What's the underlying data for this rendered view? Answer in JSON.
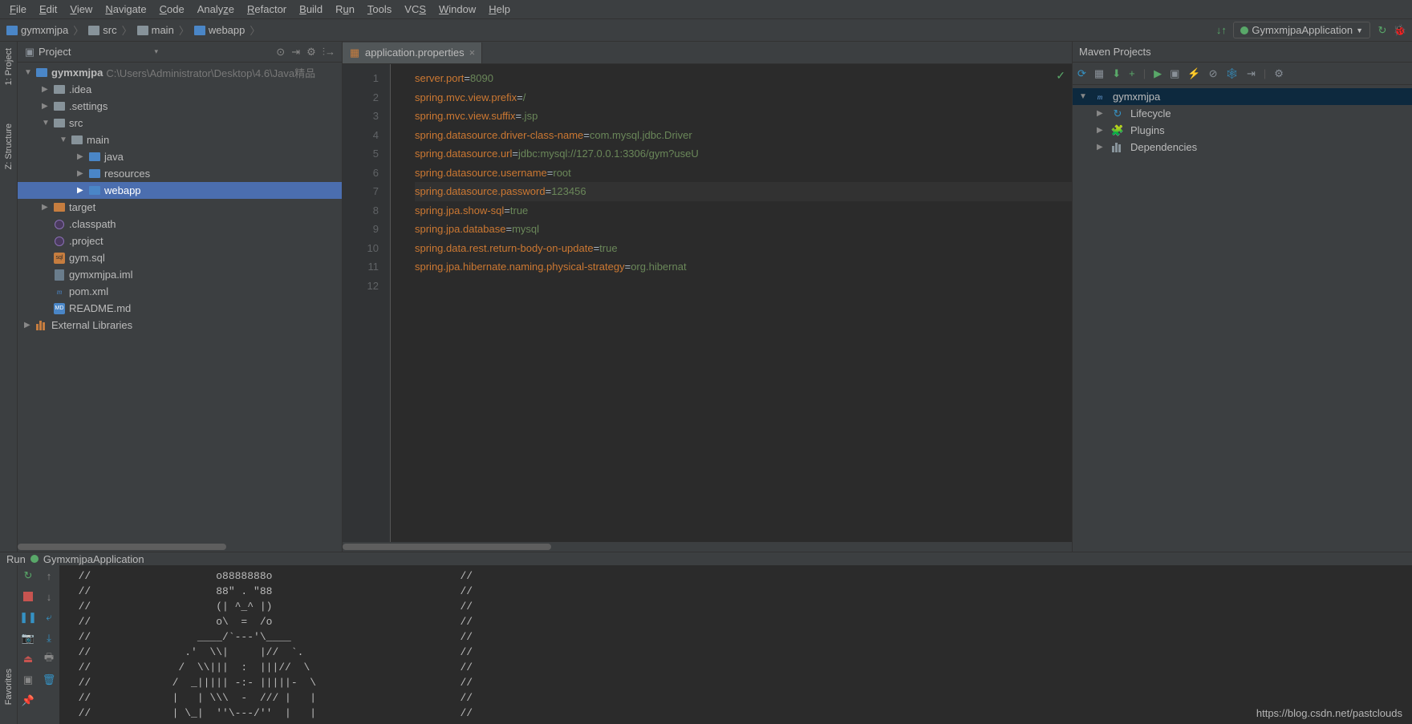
{
  "menu": [
    "File",
    "Edit",
    "View",
    "Navigate",
    "Code",
    "Analyze",
    "Refactor",
    "Build",
    "Run",
    "Tools",
    "VCS",
    "Window",
    "Help"
  ],
  "breadcrumb": [
    "gymxmjpa",
    "src",
    "main",
    "webapp"
  ],
  "run_config": "GymxmjpaApplication",
  "project_panel": {
    "title": "Project",
    "root": {
      "name": "gymxmjpa",
      "path": "C:\\Users\\Administrator\\Desktop\\4.6\\Java精品"
    },
    "items": {
      "idea": ".idea",
      "settings": ".settings",
      "src": "src",
      "main": "main",
      "java": "java",
      "resources": "resources",
      "webapp": "webapp",
      "target": "target",
      "classpath": ".classpath",
      "project": ".project",
      "gymsql": "gym.sql",
      "iml": "gymxmjpa.iml",
      "pom": "pom.xml",
      "readme": "README.md",
      "ext": "External Libraries"
    }
  },
  "editor": {
    "tab": "application.properties",
    "lines": [
      {
        "n": 1,
        "k": "server.port",
        "v": "8090"
      },
      {
        "n": 2,
        "k": "spring.mvc.view.prefix",
        "v": "/"
      },
      {
        "n": 3,
        "k": "spring.mvc.view.suffix",
        "v": ".jsp"
      },
      {
        "n": 4,
        "k": "spring.datasource.driver-class-name",
        "v": "com.mysql.jdbc.Driver"
      },
      {
        "n": 5,
        "k": "spring.datasource.url",
        "v": "jdbc:mysql://127.0.0.1:3306/gym?useU"
      },
      {
        "n": 6,
        "k": "spring.datasource.username",
        "v": "root"
      },
      {
        "n": 7,
        "k": "spring.datasource.password",
        "v": "123456"
      },
      {
        "n": 8,
        "k": "spring.jpa.show-sql",
        "v": "true"
      },
      {
        "n": 9,
        "k": "spring.jpa.database",
        "v": "mysql"
      },
      {
        "n": 10,
        "k": "spring.data.rest.return-body-on-update",
        "v": "true"
      },
      {
        "n": 11,
        "k": "spring.jpa.hibernate.naming.physical-strategy",
        "v": "org.hibernat"
      },
      {
        "n": 12,
        "k": "",
        "v": ""
      }
    ],
    "current_line": 7
  },
  "maven": {
    "title": "Maven Projects",
    "root": "gymxmjpa",
    "items": [
      "Lifecycle",
      "Plugins",
      "Dependencies"
    ]
  },
  "run": {
    "title": "Run",
    "app": "GymxmjpaApplication",
    "console": "  //                    o8888888o                              //\n  //                    88\" . \"88                              //\n  //                    (| ^_^ |)                              //\n  //                    o\\  =  /o                              //\n  //                 ____/`---'\\____                           //\n  //               .'  \\\\|     |//  `.                         //\n  //              /  \\\\|||  :  |||//  \\                        //\n  //             /  _||||| -:- |||||-  \\                       //\n  //             |   | \\\\\\  -  /// |   |                       //\n  //             | \\_|  ''\\---/''  |   |                       //"
  },
  "gutter_labels": {
    "project": "1: Project",
    "structure": "Z: Structure",
    "favorites": "Favorites"
  },
  "watermark": "https://blog.csdn.net/pastclouds"
}
